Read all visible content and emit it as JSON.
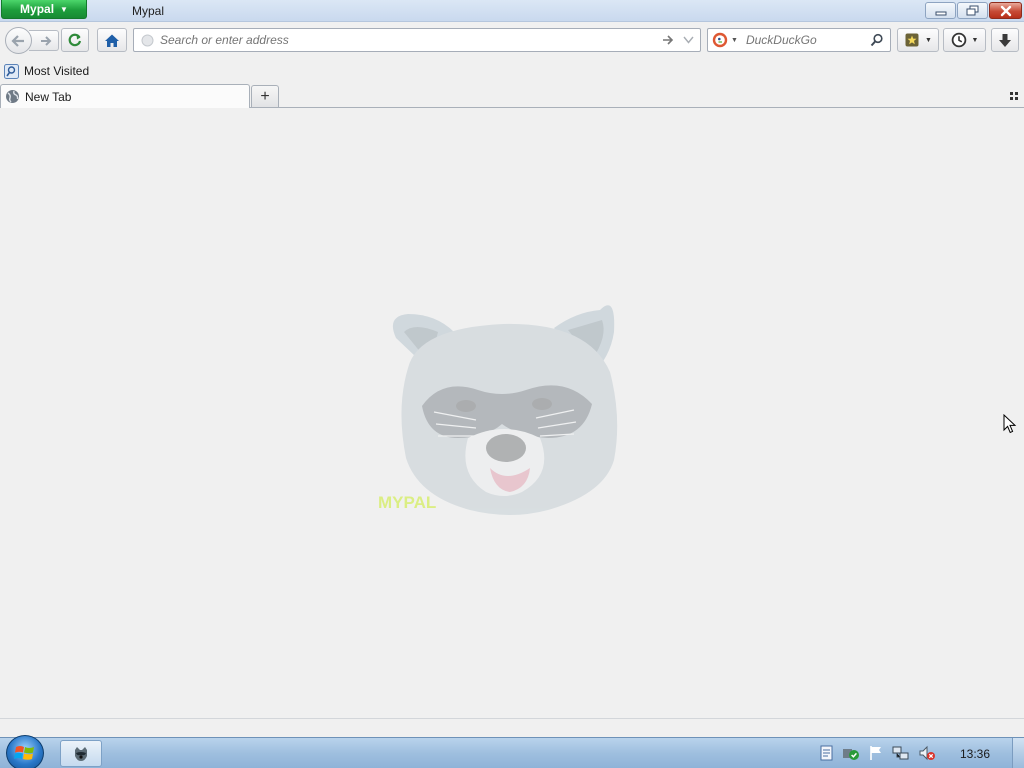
{
  "window": {
    "app_menu_label": "Mypal",
    "title": "Mypal"
  },
  "navbar": {
    "url_placeholder": "Search or enter address",
    "search_engine": "DuckDuckGo",
    "search_placeholder": "DuckDuckGo"
  },
  "bookmarks_bar": {
    "items": [
      {
        "label": "Most Visited",
        "icon": "most-visited-icon"
      }
    ]
  },
  "tabs": [
    {
      "label": "New Tab",
      "icon": "globe-icon",
      "active": true
    }
  ],
  "new_tab_button_label": "+",
  "content": {
    "mascot": "raccoon-logo",
    "watermark_text": "MYPAL"
  },
  "taskbar": {
    "pinned": [
      {
        "name": "mypal-taskbar-icon"
      }
    ],
    "tray_icons": [
      "notes-icon",
      "security-shield-icon",
      "flag-icon",
      "network-icon",
      "volume-muted-icon"
    ],
    "clock": "13:36"
  },
  "colors": {
    "app_menu_green": "#1d9e3c",
    "close_red": "#c74b36",
    "taskbar_blue": "#9fbfdf",
    "content_bg": "#f0f0f0"
  }
}
